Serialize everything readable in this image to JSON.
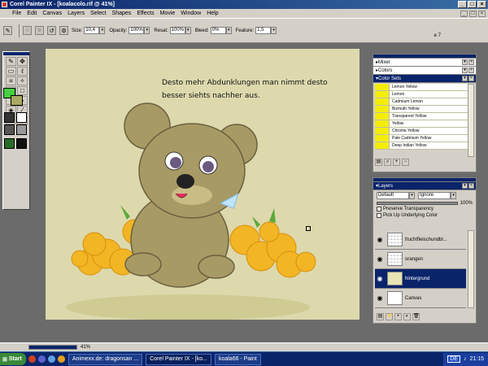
{
  "window": {
    "title": "Corel Painter IX - [koalacolo.rif @ 41%]"
  },
  "menu": [
    "File",
    "Edit",
    "Canvas",
    "Layers",
    "Select",
    "Shapes",
    "Effects",
    "Movie",
    "Window",
    "Help"
  ],
  "propbar": {
    "size_label": "Size:",
    "size_value": "10,4",
    "opacity_label": "Opacity:",
    "opacity_value": "100%",
    "resat_label": "Resat:",
    "resat_value": "100%",
    "bleed_label": "Bleed:",
    "bleed_value": "0%",
    "feature_label": "Feature:",
    "feature_value": "1,5"
  },
  "page_label": "e 7",
  "canvas": {
    "text_line1": "Desto mehr Abdunklungen  man nimmt desto",
    "text_line2": "besser siehts nachher aus."
  },
  "panels": {
    "mixer": "Mixer",
    "colors": "Colors",
    "color_sets": "Color Sets",
    "color_list": [
      "Lemon Yellow",
      "Lemon",
      "Cadmium Lemon",
      "Bizmuth Yellow",
      "Transparent Yellow",
      "Yellow",
      "Chrome Yellow",
      "Pale Cadmium Yellow",
      "Deep Indian Yellow"
    ],
    "layers": {
      "title": "Layers",
      "composite": "Default",
      "depth": "Ignore",
      "opacity": "100%",
      "preserve": "Preserve Transparency",
      "pickup": "Pick Up Underlying Color",
      "items": [
        "fruchtfleischundbl...",
        "orangen",
        "hintergrund",
        "Canvas"
      ]
    }
  },
  "status": {
    "zoom": "41%"
  },
  "taskbar": {
    "start": "Start",
    "tasks": [
      "Animexx.de: dragonsan ...",
      "Corel Painter IX - [ko...",
      "koala66 - Paint"
    ],
    "lang": "DE",
    "time": "21:15"
  },
  "colors": {
    "canvas_bg": "#ddd9ad",
    "yellow_chip": "#f4ed08",
    "selection": "#0a246a"
  }
}
